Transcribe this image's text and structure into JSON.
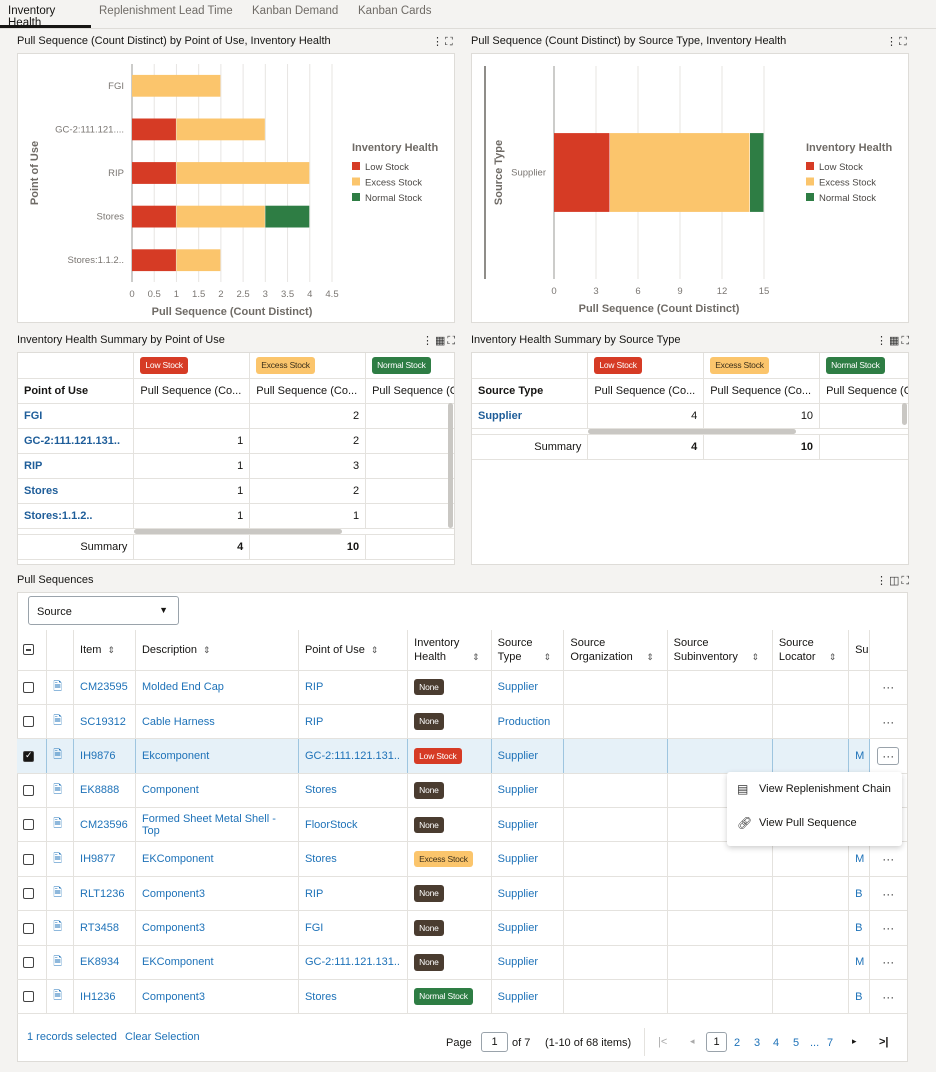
{
  "tabs": [
    {
      "label": "Inventory Health",
      "active": true
    },
    {
      "label": "Replenishment Lead Time",
      "active": false
    },
    {
      "label": "Kanban Demand",
      "active": false
    },
    {
      "label": "Kanban Cards",
      "active": false
    }
  ],
  "colors": {
    "low_stock": "#d63b25",
    "excess_stock": "#fbc56c",
    "normal_stock": "#2e7d44",
    "none": "#4a3c30",
    "link": "#1e72b8"
  },
  "panels": {
    "chart1_title": "Pull Sequence (Count Distinct) by Point of Use, Inventory Health",
    "chart2_title": "Pull Sequence (Count Distinct) by Source Type, Inventory Health",
    "table1_title": "Inventory Health Summary by Point of Use",
    "table2_title": "Inventory Health Summary by Source Type",
    "pull_sequences_title": "Pull Sequences",
    "tools_more": "⋮",
    "tools_expand": "⛶"
  },
  "chart_data": [
    {
      "type": "bar",
      "orientation": "horizontal",
      "stacked": true,
      "title": "Pull Sequence (Count Distinct) by Point of Use, Inventory Health",
      "xlabel": "Pull Sequence (Count Distinct)",
      "ylabel": "Point of Use",
      "categories": [
        "FGI",
        "GC-2:111.121....",
        "RIP",
        "Stores",
        "Stores:1.1.2.."
      ],
      "series": [
        {
          "name": "Low Stock",
          "values": [
            0,
            1,
            1,
            1,
            1
          ]
        },
        {
          "name": "Excess Stock",
          "values": [
            2,
            2,
            3,
            2,
            1
          ]
        },
        {
          "name": "Normal Stock",
          "values": [
            0,
            0,
            0,
            1,
            0
          ]
        }
      ],
      "xlim": [
        0,
        4.5
      ],
      "xticks": [
        "0",
        "0.5",
        "1",
        "1.5",
        "2",
        "2.5",
        "3",
        "3.5",
        "4",
        "4.5"
      ],
      "legend_title": "Inventory Health",
      "legend": "right",
      "grid": true
    },
    {
      "type": "bar",
      "orientation": "horizontal",
      "stacked": true,
      "title": "Pull Sequence (Count Distinct) by Source Type, Inventory Health",
      "xlabel": "Pull Sequence (Count Distinct)",
      "ylabel": "Source Type",
      "categories": [
        "Supplier"
      ],
      "series": [
        {
          "name": "Low Stock",
          "values": [
            4
          ]
        },
        {
          "name": "Excess Stock",
          "values": [
            10
          ]
        },
        {
          "name": "Normal Stock",
          "values": [
            1
          ]
        }
      ],
      "xlim": [
        0,
        15
      ],
      "xticks": [
        "0",
        "3",
        "6",
        "9",
        "12",
        "15"
      ],
      "legend_title": "Inventory Health",
      "legend": "right",
      "grid": true
    }
  ],
  "summary_pou": {
    "badges": [
      "Low Stock",
      "Excess Stock",
      "Normal Stock"
    ],
    "row_header": "Point of Use",
    "col_headers": [
      "Pull Sequence (Co...",
      "Pull Sequence (Co...",
      "Pull Sequence (C"
    ],
    "rows": [
      {
        "name": "FGI",
        "low": "",
        "excess": "2",
        "normal": ""
      },
      {
        "name": "GC-2:111.121.131..",
        "low": "1",
        "excess": "2",
        "normal": ""
      },
      {
        "name": "RIP",
        "low": "1",
        "excess": "3",
        "normal": ""
      },
      {
        "name": "Stores",
        "low": "1",
        "excess": "2",
        "normal": ""
      },
      {
        "name": "Stores:1.1.2..",
        "low": "1",
        "excess": "1",
        "normal": ""
      }
    ],
    "summary": {
      "label": "Summary",
      "low": "4",
      "excess": "10",
      "normal": ""
    }
  },
  "summary_src": {
    "badges": [
      "Low Stock",
      "Excess Stock",
      "Normal Stock"
    ],
    "row_header": "Source Type",
    "col_headers": [
      "Pull Sequence (Co...",
      "Pull Sequence (Co...",
      "Pull Sequence (C"
    ],
    "rows": [
      {
        "name": "Supplier",
        "low": "4",
        "excess": "10",
        "normal": ""
      }
    ],
    "summary": {
      "label": "Summary",
      "low": "4",
      "excess": "10",
      "normal": ""
    }
  },
  "pull_sequences": {
    "filter_select": "Source",
    "columns": [
      "Item",
      "Description",
      "Point of Use",
      "Inventory Health",
      "Source Type",
      "Source Organization",
      "Source Subinventory",
      "Source Locator",
      "Su"
    ],
    "rows": [
      {
        "item": "CM23595",
        "desc": "Molded End Cap",
        "pou": "RIP",
        "health": "None",
        "hclass": "b-none",
        "stype": "Supplier",
        "trunc": "",
        "selected": false
      },
      {
        "item": "SC19312",
        "desc": "Cable Harness",
        "pou": "RIP",
        "health": "None",
        "hclass": "b-none",
        "stype": "Production",
        "trunc": "",
        "selected": false
      },
      {
        "item": "IH9876",
        "desc": "Ekcomponent",
        "pou": "GC-2:111.121.131..",
        "health": "Low Stock",
        "hclass": "b-low",
        "stype": "Supplier",
        "trunc": "M",
        "selected": true
      },
      {
        "item": "EK8888",
        "desc": "Component",
        "pou": "Stores",
        "health": "None",
        "hclass": "b-none",
        "stype": "Supplier",
        "trunc": "",
        "selected": false
      },
      {
        "item": "CM23596",
        "desc": "Formed Sheet Metal Shell - Top",
        "pou": "FloorStock",
        "health": "None",
        "hclass": "b-none",
        "stype": "Supplier",
        "trunc": "",
        "selected": false
      },
      {
        "item": "IH9877",
        "desc": "EKComponent",
        "pou": "Stores",
        "health": "Excess Stock",
        "hclass": "b-excess",
        "stype": "Supplier",
        "trunc": "M",
        "selected": false
      },
      {
        "item": "RLT1236",
        "desc": "Component3",
        "pou": "RIP",
        "health": "None",
        "hclass": "b-none",
        "stype": "Supplier",
        "trunc": "B",
        "selected": false
      },
      {
        "item": "RT3458",
        "desc": "Component3",
        "pou": "FGI",
        "health": "None",
        "hclass": "b-none",
        "stype": "Supplier",
        "trunc": "B",
        "selected": false
      },
      {
        "item": "EK8934",
        "desc": "EKComponent",
        "pou": "GC-2:111.121.131..",
        "health": "None",
        "hclass": "b-none",
        "stype": "Supplier",
        "trunc": "M",
        "selected": false
      },
      {
        "item": "IH1236",
        "desc": "Component3",
        "pou": "Stores",
        "health": "Normal Stock",
        "hclass": "b-normal",
        "stype": "Supplier",
        "trunc": "B",
        "selected": false
      }
    ],
    "context_menu": [
      {
        "label": "View Replenishment Chain",
        "icon": "replenishment-chain-icon"
      },
      {
        "label": "View Pull Sequence",
        "icon": "link-icon"
      }
    ]
  },
  "footer": {
    "selected_text": "1 records selected",
    "clear_selection": "Clear Selection",
    "page_label": "Page",
    "page_value": "1",
    "of_pages": "of 7",
    "range": "(1-10 of 68 items)",
    "pages": [
      "1",
      "2",
      "3",
      "4",
      "5",
      "...",
      "7"
    ]
  }
}
